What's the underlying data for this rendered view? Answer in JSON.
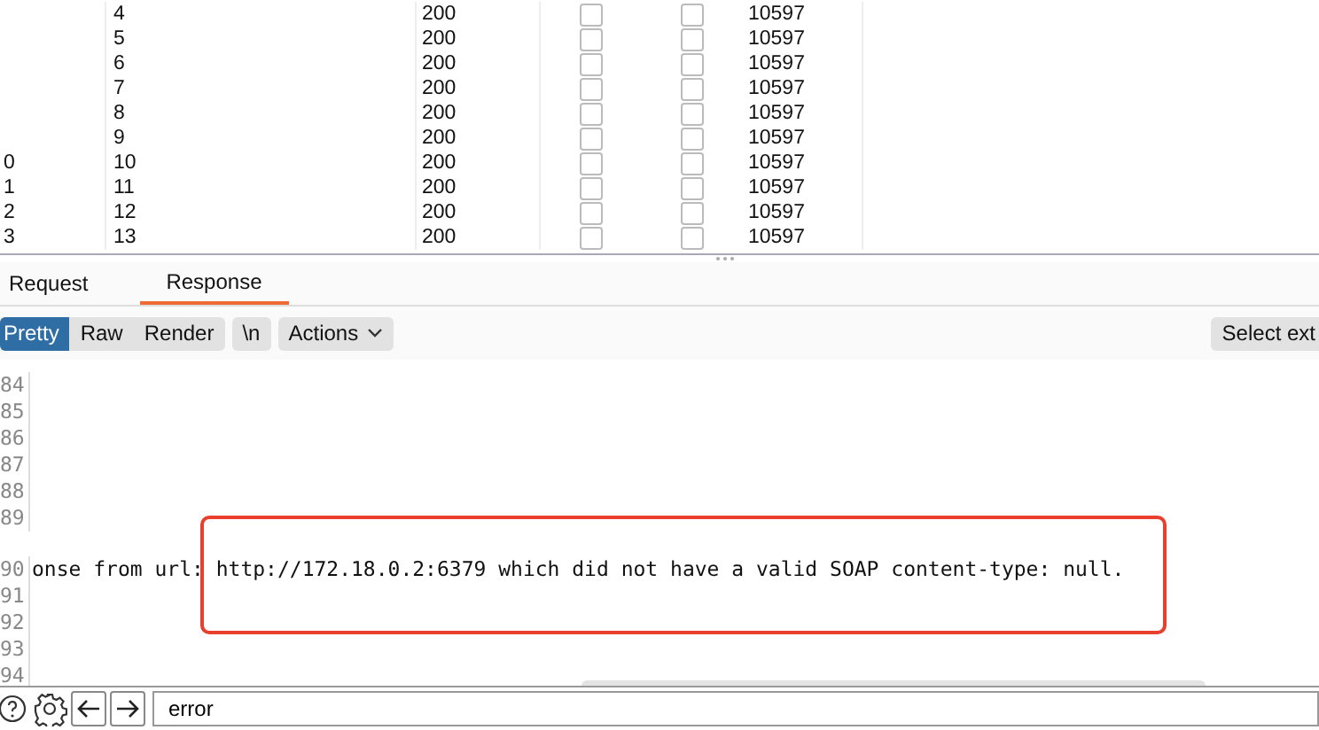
{
  "results_table": {
    "rows": [
      {
        "payload": "4",
        "status": "200",
        "error": false,
        "timeout": false,
        "length": "10597"
      },
      {
        "payload": "5",
        "status": "200",
        "error": false,
        "timeout": false,
        "length": "10597"
      },
      {
        "payload": "6",
        "status": "200",
        "error": false,
        "timeout": false,
        "length": "10597"
      },
      {
        "payload": "7",
        "status": "200",
        "error": false,
        "timeout": false,
        "length": "10597"
      },
      {
        "payload": "8",
        "status": "200",
        "error": false,
        "timeout": false,
        "length": "10597"
      },
      {
        "payload": "9",
        "status": "200",
        "error": false,
        "timeout": false,
        "length": "10597"
      },
      {
        "column_1": "0",
        "payload": "10",
        "status": "200",
        "error": false,
        "timeout": false,
        "length": "10597"
      },
      {
        "column_1": "1",
        "payload": "11",
        "status": "200",
        "error": false,
        "timeout": false,
        "length": "10597"
      },
      {
        "column_1": "2",
        "payload": "12",
        "status": "200",
        "error": false,
        "timeout": false,
        "length": "10597"
      },
      {
        "column_1": "3",
        "payload": "13",
        "status": "200",
        "error": false,
        "timeout": false,
        "length": "10597"
      }
    ]
  },
  "tabs": [
    {
      "label": "Request",
      "selected": false
    },
    {
      "label": "Response",
      "selected": true
    }
  ],
  "view_modes": [
    {
      "label": "Pretty",
      "selected": true
    },
    {
      "label": "Raw",
      "selected": false
    },
    {
      "label": "Render",
      "selected": false
    }
  ],
  "newline_button": "\\n",
  "actions_button": "Actions",
  "select_button": "Select ext",
  "editor": {
    "lines": [
      {
        "number": "84"
      },
      {
        "number": "85"
      },
      {
        "number": "86"
      },
      {
        "number": "87"
      },
      {
        "number": "88"
      },
      {
        "number": "89"
      },
      {
        "number": "90",
        "text": "onse from url: http://172.18.0.2:6379 which did not have a valid SOAP content-type: null."
      },
      {
        "number": "91"
      },
      {
        "number": "92"
      },
      {
        "number": "93"
      },
      {
        "number": "94"
      }
    ]
  },
  "search": {
    "value": "error"
  }
}
